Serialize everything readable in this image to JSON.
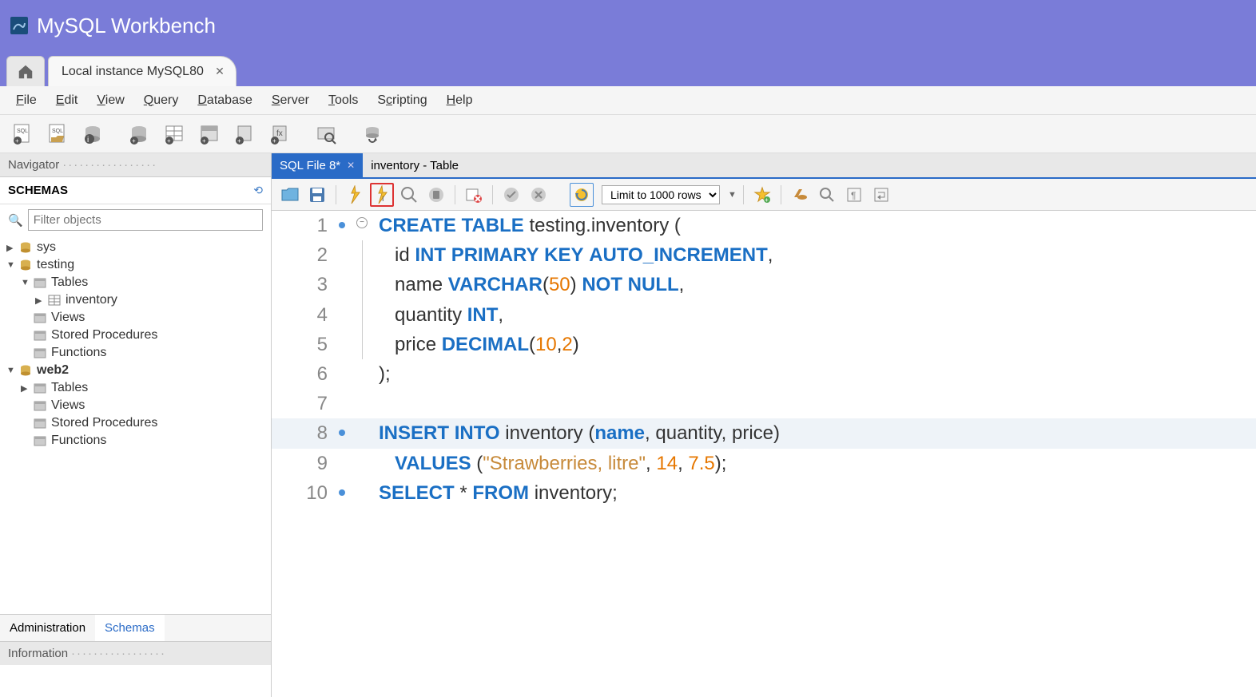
{
  "app": {
    "title": "MySQL Workbench"
  },
  "connection_tab": {
    "label": "Local instance MySQL80"
  },
  "menu": {
    "file": "File",
    "edit": "Edit",
    "view": "View",
    "query": "Query",
    "database": "Database",
    "server": "Server",
    "tools": "Tools",
    "scripting": "Scripting",
    "help": "Help"
  },
  "navigator": {
    "title": "Navigator",
    "schemas_title": "SCHEMAS",
    "filter_placeholder": "Filter objects",
    "tabs": {
      "admin": "Administration",
      "schemas": "Schemas"
    },
    "info_title": "Information"
  },
  "tree": {
    "sys": "sys",
    "testing": "testing",
    "tables": "Tables",
    "inventory": "inventory",
    "views": "Views",
    "stored_procedures": "Stored Procedures",
    "functions": "Functions",
    "web2": "web2"
  },
  "editor": {
    "tabs": {
      "sql_file": "SQL File 8*",
      "inventory_table": "inventory - Table"
    },
    "limit_label": "Limit to 1000 rows"
  },
  "code": {
    "lines": [
      {
        "n": "1",
        "dots": 1,
        "fold": true
      },
      {
        "n": "2"
      },
      {
        "n": "3"
      },
      {
        "n": "4"
      },
      {
        "n": "5"
      },
      {
        "n": "6"
      },
      {
        "n": "7"
      },
      {
        "n": "8",
        "dots": 1,
        "hl": true
      },
      {
        "n": "9"
      },
      {
        "n": "10",
        "dots": 1
      }
    ],
    "content": {
      "l1_create": "CREATE",
      "l1_table": "TABLE",
      "l1_name": "testing.inventory",
      "l1_open": " (",
      "l2_id": "id",
      "l2_int": "INT",
      "l2_pk": "PRIMARY",
      "l2_key": "KEY",
      "l2_ai": "AUTO_INCREMENT",
      "l2_comma": ",",
      "l3_name": "name",
      "l3_varchar": "VARCHAR",
      "l3_open": "(",
      "l3_50": "50",
      "l3_close": ")",
      "l3_not": "NOT",
      "l3_null": "NULL",
      "l3_comma": ",",
      "l4_qty": "quantity",
      "l4_int": "INT",
      "l4_comma": ",",
      "l5_price": "price",
      "l5_dec": "DECIMAL",
      "l5_open": "(",
      "l5_10": "10",
      "l5_c": ",",
      "l5_2": "2",
      "l5_close": ")",
      "l6_close": ");",
      "l8_insert": "INSERT",
      "l8_into": "INTO",
      "l8_inv": "inventory",
      "l8_open": " (",
      "l8_name": "name",
      "l8_c1": ",",
      "l8_qty": " quantity",
      "l8_c2": ",",
      "l8_price": " price",
      "l8_close": ")",
      "l9_values": "VALUES",
      "l9_open": " (",
      "l9_str": "\"Strawberries, litre\"",
      "l9_c1": ",",
      "l9_14": " 14",
      "l9_c2": ",",
      "l9_75": " 7.5",
      "l9_close": ");",
      "l10_select": "SELECT",
      "l10_star": " *",
      "l10_from": "FROM",
      "l10_inv": " inventory",
      "l10_semi": ";"
    }
  }
}
